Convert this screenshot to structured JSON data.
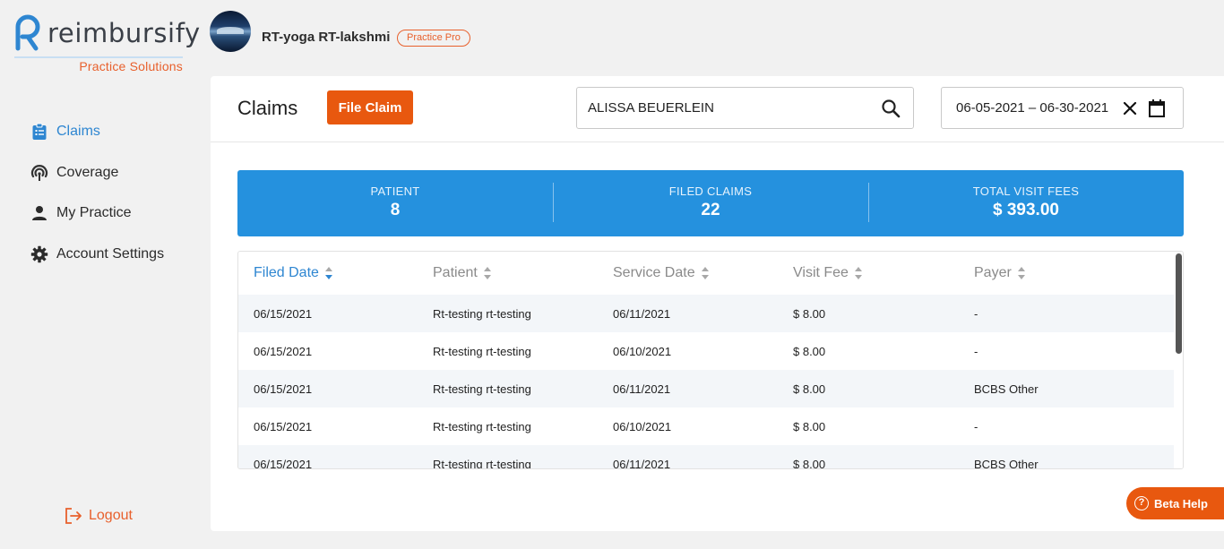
{
  "brand": {
    "name": "reimbursify",
    "subtitle": "Practice Solutions"
  },
  "user": {
    "name": "RT-yoga RT-lakshmi",
    "plan": "Practice Pro"
  },
  "sidebar": {
    "items": [
      {
        "label": "Claims",
        "icon": "clipboard-icon",
        "active": true
      },
      {
        "label": "Coverage",
        "icon": "coverage-icon",
        "active": false
      },
      {
        "label": "My Practice",
        "icon": "person-icon",
        "active": false
      },
      {
        "label": "Account Settings",
        "icon": "gear-icon",
        "active": false
      }
    ],
    "logout": "Logout"
  },
  "header": {
    "title": "Claims",
    "file_claim": "File Claim",
    "search_value": "ALISSA BEUERLEIN",
    "date_range": "06-05-2021 – 06-30-2021"
  },
  "stats": {
    "patient": {
      "label": "PATIENT",
      "value": "8"
    },
    "filed": {
      "label": "FILED CLAIMS",
      "value": "22"
    },
    "fees": {
      "label": "TOTAL VISIT FEES",
      "value": "$ 393.00"
    }
  },
  "table": {
    "columns": [
      "Filed Date",
      "Patient",
      "Service Date",
      "Visit Fee",
      "Payer"
    ],
    "sorted_by": "Filed Date",
    "rows": [
      [
        "06/15/2021",
        "Rt-testing rt-testing",
        "06/11/2021",
        "$ 8.00",
        "-"
      ],
      [
        "06/15/2021",
        "Rt-testing rt-testing",
        "06/10/2021",
        "$ 8.00",
        "-"
      ],
      [
        "06/15/2021",
        "Rt-testing rt-testing",
        "06/11/2021",
        "$ 8.00",
        "BCBS Other"
      ],
      [
        "06/15/2021",
        "Rt-testing rt-testing",
        "06/10/2021",
        "$ 8.00",
        "-"
      ],
      [
        "06/15/2021",
        "Rt-testing rt-testing",
        "06/11/2021",
        "$ 8.00",
        "BCBS Other"
      ]
    ]
  },
  "beta_help": "Beta Help",
  "colors": {
    "accent": "#2591de",
    "brand_orange": "#e8580f",
    "active_link": "#2e86d1"
  }
}
